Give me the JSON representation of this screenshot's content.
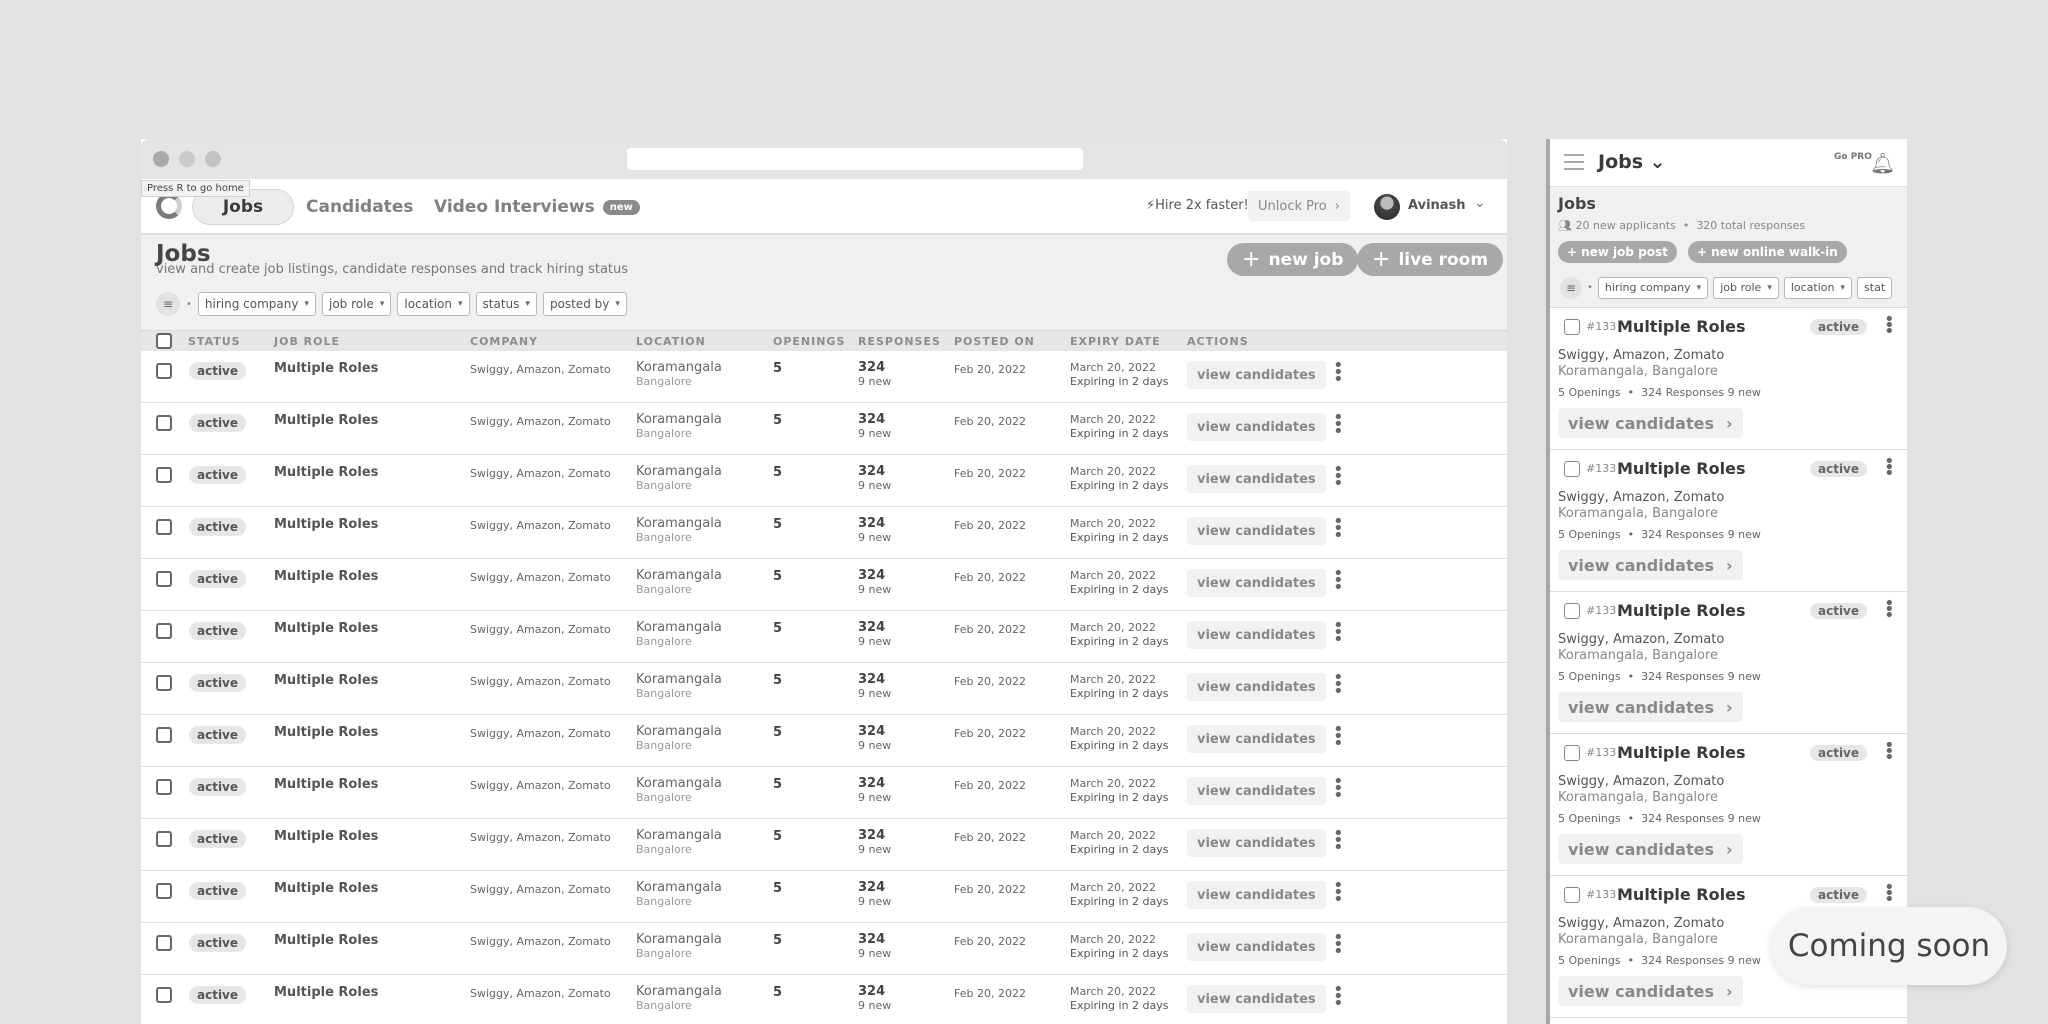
{
  "browser": {
    "tooltip": "Press R to go home"
  },
  "nav": {
    "tabs": [
      "Jobs",
      "Candidates",
      "Video Interviews"
    ],
    "new_badge": "new",
    "hire_text": "⚡Hire 2x faster!",
    "unlock_label": "Unlock Pro",
    "user_name": "Avinash"
  },
  "page": {
    "title": "Jobs",
    "subtitle": "view and create job listings, candidate responses and track hiring status",
    "new_job": "new job",
    "live_room": "live room",
    "filters": [
      "hiring company",
      "job role",
      "location",
      "status",
      "posted by"
    ]
  },
  "table": {
    "headers": [
      "STATUS",
      "JOB ROLE",
      "COMPANY",
      "LOCATION",
      "OPENINGS",
      "RESPONSES",
      "POSTED ON",
      "EXPIRY DATE",
      "ACTIONS"
    ],
    "rows": [
      {
        "status": "active",
        "role": "Multiple Roles",
        "company": "Swiggy, Amazon, Zomato",
        "area": "Koramangala",
        "city": "Bangalore",
        "openings": "5",
        "responses": "324",
        "new": "9 new",
        "posted": "Feb 20, 2022",
        "expiry": "March 20, 2022",
        "expiring": "Expiring in 2 days",
        "action": "view candidates"
      },
      {
        "status": "active",
        "role": "Multiple Roles",
        "company": "Swiggy, Amazon, Zomato",
        "area": "Koramangala",
        "city": "Bangalore",
        "openings": "5",
        "responses": "324",
        "new": "9 new",
        "posted": "Feb 20, 2022",
        "expiry": "March 20, 2022",
        "expiring": "Expiring in 2 days",
        "action": "view candidates"
      },
      {
        "status": "active",
        "role": "Multiple Roles",
        "company": "Swiggy, Amazon, Zomato",
        "area": "Koramangala",
        "city": "Bangalore",
        "openings": "5",
        "responses": "324",
        "new": "9 new",
        "posted": "Feb 20, 2022",
        "expiry": "March 20, 2022",
        "expiring": "Expiring in 2 days",
        "action": "view candidates"
      },
      {
        "status": "active",
        "role": "Multiple Roles",
        "company": "Swiggy, Amazon, Zomato",
        "area": "Koramangala",
        "city": "Bangalore",
        "openings": "5",
        "responses": "324",
        "new": "9 new",
        "posted": "Feb 20, 2022",
        "expiry": "March 20, 2022",
        "expiring": "Expiring in 2 days",
        "action": "view candidates"
      },
      {
        "status": "active",
        "role": "Multiple Roles",
        "company": "Swiggy, Amazon, Zomato",
        "area": "Koramangala",
        "city": "Bangalore",
        "openings": "5",
        "responses": "324",
        "new": "9 new",
        "posted": "Feb 20, 2022",
        "expiry": "March 20, 2022",
        "expiring": "Expiring in 2 days",
        "action": "view candidates"
      },
      {
        "status": "active",
        "role": "Multiple Roles",
        "company": "Swiggy, Amazon, Zomato",
        "area": "Koramangala",
        "city": "Bangalore",
        "openings": "5",
        "responses": "324",
        "new": "9 new",
        "posted": "Feb 20, 2022",
        "expiry": "March 20, 2022",
        "expiring": "Expiring in 2 days",
        "action": "view candidates"
      },
      {
        "status": "active",
        "role": "Multiple Roles",
        "company": "Swiggy, Amazon, Zomato",
        "area": "Koramangala",
        "city": "Bangalore",
        "openings": "5",
        "responses": "324",
        "new": "9 new",
        "posted": "Feb 20, 2022",
        "expiry": "March 20, 2022",
        "expiring": "Expiring in 2 days",
        "action": "view candidates"
      },
      {
        "status": "active",
        "role": "Multiple Roles",
        "company": "Swiggy, Amazon, Zomato",
        "area": "Koramangala",
        "city": "Bangalore",
        "openings": "5",
        "responses": "324",
        "new": "9 new",
        "posted": "Feb 20, 2022",
        "expiry": "March 20, 2022",
        "expiring": "Expiring in 2 days",
        "action": "view candidates"
      },
      {
        "status": "active",
        "role": "Multiple Roles",
        "company": "Swiggy, Amazon, Zomato",
        "area": "Koramangala",
        "city": "Bangalore",
        "openings": "5",
        "responses": "324",
        "new": "9 new",
        "posted": "Feb 20, 2022",
        "expiry": "March 20, 2022",
        "expiring": "Expiring in 2 days",
        "action": "view candidates"
      },
      {
        "status": "active",
        "role": "Multiple Roles",
        "company": "Swiggy, Amazon, Zomato",
        "area": "Koramangala",
        "city": "Bangalore",
        "openings": "5",
        "responses": "324",
        "new": "9 new",
        "posted": "Feb 20, 2022",
        "expiry": "March 20, 2022",
        "expiring": "Expiring in 2 days",
        "action": "view candidates"
      },
      {
        "status": "active",
        "role": "Multiple Roles",
        "company": "Swiggy, Amazon, Zomato",
        "area": "Koramangala",
        "city": "Bangalore",
        "openings": "5",
        "responses": "324",
        "new": "9 new",
        "posted": "Feb 20, 2022",
        "expiry": "March 20, 2022",
        "expiring": "Expiring in 2 days",
        "action": "view candidates"
      },
      {
        "status": "active",
        "role": "Multiple Roles",
        "company": "Swiggy, Amazon, Zomato",
        "area": "Koramangala",
        "city": "Bangalore",
        "openings": "5",
        "responses": "324",
        "new": "9 new",
        "posted": "Feb 20, 2022",
        "expiry": "March 20, 2022",
        "expiring": "Expiring in 2 days",
        "action": "view candidates"
      },
      {
        "status": "active",
        "role": "Multiple Roles",
        "company": "Swiggy, Amazon, Zomato",
        "area": "Koramangala",
        "city": "Bangalore",
        "openings": "5",
        "responses": "324",
        "new": "9 new",
        "posted": "Feb 20, 2022",
        "expiry": "March 20, 2022",
        "expiring": "Expiring in 2 days",
        "action": "view candidates"
      }
    ]
  },
  "mobile": {
    "title": "Jobs",
    "gopro": "Go PRO",
    "heading": "Jobs",
    "applicants": "20 new applicants",
    "responses": "320 total responses",
    "new_job_post": "new job post",
    "new_walkin": "new online walk-in",
    "filters": [
      "hiring company",
      "job role",
      "location",
      "stat"
    ],
    "cards": [
      {
        "id": "#133",
        "role": "Multiple Roles",
        "status": "active",
        "company": "Swiggy, Amazon, Zomato",
        "location": "Koramangala, Bangalore",
        "openings": "5 Openings",
        "responses": "324 Responses",
        "new": "9 new",
        "action": "view candidates"
      },
      {
        "id": "#133",
        "role": "Multiple Roles",
        "status": "active",
        "company": "Swiggy, Amazon, Zomato",
        "location": "Koramangala, Bangalore",
        "openings": "5 Openings",
        "responses": "324 Responses",
        "new": "9 new",
        "action": "view candidates"
      },
      {
        "id": "#133",
        "role": "Multiple Roles",
        "status": "active",
        "company": "Swiggy, Amazon, Zomato",
        "location": "Koramangala, Bangalore",
        "openings": "5 Openings",
        "responses": "324 Responses",
        "new": "9 new",
        "action": "view candidates"
      },
      {
        "id": "#133",
        "role": "Multiple Roles",
        "status": "active",
        "company": "Swiggy, Amazon, Zomato",
        "location": "Koramangala, Bangalore",
        "openings": "5 Openings",
        "responses": "324 Responses",
        "new": "9 new",
        "action": "view candidates"
      },
      {
        "id": "#133",
        "role": "Multiple Roles",
        "status": "active",
        "company": "Swiggy, Amazon, Zomato",
        "location": "Koramangala, Bangalore",
        "openings": "5 Openings",
        "responses": "324 Responses",
        "new": "9 new",
        "action": "view candidates"
      }
    ]
  },
  "coming_soon": "Coming soon"
}
